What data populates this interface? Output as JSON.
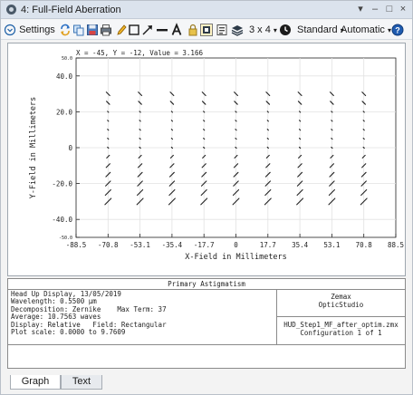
{
  "window": {
    "title": "4: Full-Field Aberration",
    "controls": {
      "menu": "▾",
      "minimize": "–",
      "restore": "□",
      "close": "×"
    }
  },
  "toolbar": {
    "settings_label": "Settings",
    "grid_label": "3 x 4",
    "standard_label": "Standard",
    "automatic_label": "Automatic",
    "icons": [
      "settings-chevron-icon",
      "refresh-icon",
      "copy-icon",
      "save-icon",
      "print-icon",
      "pencil-icon",
      "rectangle-icon",
      "arrow-icon",
      "line-icon",
      "text-icon",
      "lock-icon",
      "window-icon",
      "export-icon",
      "layers-icon",
      "clock-icon",
      "help-icon"
    ]
  },
  "graph": {
    "cursor_readout": "X = -45, Y = -12, Value = 3.166",
    "xlabel": "X-Field in Millimeters",
    "ylabel": "Y-Field in Millimeters",
    "x_ticks": [
      "-88.5",
      "-70.8",
      "-53.1",
      "-35.4",
      "-17.7",
      "0",
      "17.7",
      "35.4",
      "53.1",
      "70.8",
      "88.5"
    ],
    "y_ticks": [
      "50.0",
      "40.0",
      "20.0",
      "0",
      "-20.0",
      "-40.0",
      "-50.0"
    ]
  },
  "chart_data": {
    "type": "scatter",
    "title": "",
    "xlabel": "X-Field in Millimeters",
    "ylabel": "Y-Field in Millimeters",
    "xlim": [
      -88.5,
      88.5
    ],
    "ylim": [
      -50.0,
      50.0
    ],
    "grid": true,
    "x_ticks": [
      -88.5,
      -70.8,
      -53.1,
      -35.4,
      -17.7,
      0,
      17.7,
      35.4,
      53.1,
      70.8,
      88.5
    ],
    "y_ticks": [
      -50.0,
      -40.0,
      -20.0,
      0,
      20.0,
      40.0,
      50.0
    ],
    "grid_x": [
      -70.8,
      -53.1,
      -35.4,
      -17.7,
      0,
      17.7,
      35.4,
      53.1,
      70.8
    ],
    "grid_y": [
      30.0,
      25.0,
      20.0,
      15.0,
      10.0,
      5.0,
      0,
      -5.0,
      -10.0,
      -15.0,
      -20.0,
      -25.0,
      -30.0
    ],
    "rows_value": [
      3.2,
      2.7,
      0.3,
      0.3,
      0.3,
      0.3,
      0.3,
      2.3,
      3.5,
      4.2,
      4.8,
      5.5,
      6.4
    ],
    "rows_angle": [
      -45,
      -45,
      -45,
      -45,
      -45,
      -45,
      -45,
      45,
      45,
      45,
      45,
      45,
      45
    ],
    "marker_style": "oriented line segments"
  },
  "info": {
    "title": "Primary Astigmatism",
    "left_lines": [
      "Head Up Display, 13/05/2019",
      "Wavelength: 0.5500 µm",
      "Decomposition: Zernike    Max Term: 37",
      "Average: 10.7563 waves",
      "Display: Relative   Field: Rectangular",
      "Plot scale: 0.0000 to 9.7609"
    ],
    "right_top": [
      "Zemax",
      "OpticStudio"
    ],
    "right_bottom": [
      "HUD_Step1_MF_after_optim.zmx",
      "Configuration 1 of 1"
    ]
  },
  "tabs": [
    {
      "label": "Graph"
    },
    {
      "label": "Text"
    }
  ]
}
